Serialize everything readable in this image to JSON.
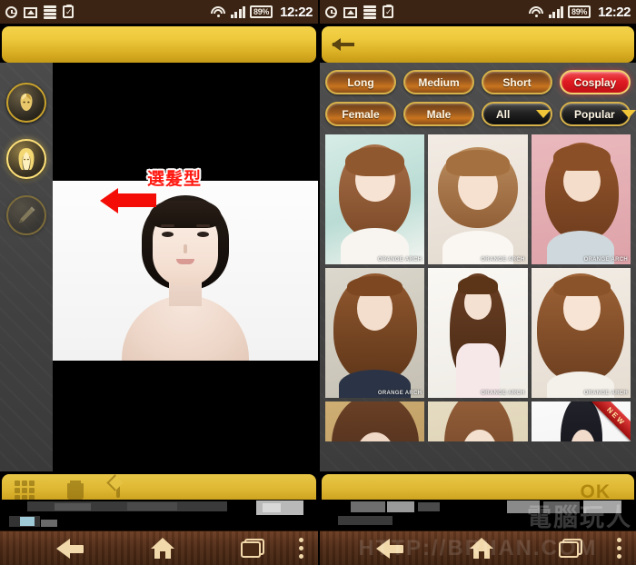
{
  "status_bar": {
    "icons": [
      "alarm-icon",
      "gallery-icon",
      "stack-icon",
      "clipboard-check-icon"
    ],
    "wifi_icon": "wifi-icon",
    "signal_icon": "signal-bars-icon",
    "battery_text": "89%",
    "clock": "12:22"
  },
  "left_panel": {
    "tools": [
      {
        "name": "face-shape-tool",
        "label": "Face",
        "state": "normal"
      },
      {
        "name": "hairstyle-tool",
        "label": "Hairstyle",
        "state": "active"
      },
      {
        "name": "edit-pen-tool",
        "label": "Edit",
        "state": "disabled"
      }
    ],
    "annotation_text": "選髮型",
    "bottom_toolbar": {
      "grid_label": "Gallery",
      "trash_label": "Delete",
      "share_label": "Save"
    }
  },
  "right_panel": {
    "back_label": "Back",
    "filters": [
      {
        "label": "Long",
        "selected": false,
        "dropdown": false
      },
      {
        "label": "Medium",
        "selected": false,
        "dropdown": false
      },
      {
        "label": "Short",
        "selected": false,
        "dropdown": false
      },
      {
        "label": "Cosplay",
        "selected": true,
        "dropdown": false
      },
      {
        "label": "Female",
        "selected": false,
        "dropdown": false
      },
      {
        "label": "Male",
        "selected": false,
        "dropdown": false
      },
      {
        "label": "All",
        "selected": false,
        "dropdown": true
      },
      {
        "label": "Popular",
        "selected": false,
        "dropdown": true
      }
    ],
    "ok_label": "OK",
    "thumbnails": [
      {
        "id": 1,
        "watermark": "ORANGE ARCH",
        "badge": null,
        "hair": "#8b5a33",
        "bg": "#cfe6e2"
      },
      {
        "id": 2,
        "watermark": "ORANGE ARCH",
        "badge": null,
        "hair": "#a87c4e",
        "bg": "#efe7de"
      },
      {
        "id": 3,
        "watermark": "ORANGE ARCH",
        "badge": null,
        "hair": "#7d4a28",
        "bg": "#e7b9bd"
      },
      {
        "id": 4,
        "watermark": "ORANGE ARCH",
        "badge": null,
        "hair": "#7b4a2c",
        "bg": "#d8d3c9"
      },
      {
        "id": 5,
        "watermark": "ORANGE ARCH",
        "badge": null,
        "hair": "#5d3620",
        "bg": "#f4f1ec"
      },
      {
        "id": 6,
        "watermark": "ORANGE ARCH",
        "badge": null,
        "hair": "#8c5730",
        "bg": "#efe9e2"
      },
      {
        "id": 7,
        "watermark": "",
        "badge": null,
        "hair": "#5d3a24",
        "bg": "#c9a870"
      },
      {
        "id": 8,
        "watermark": "",
        "badge": null,
        "hair": "#8a5a33",
        "bg": "#e0d3b8"
      },
      {
        "id": 9,
        "watermark": "",
        "badge": "NEW",
        "hair": "#1c1c22",
        "bg": "#f2f2f2"
      }
    ]
  },
  "nav_bar": {
    "back_label": "Back",
    "home_label": "Home",
    "recents_label": "Recents",
    "menu_label": "Menu"
  },
  "watermarks": {
    "url": "HTTP://BRIIAN.COM",
    "site_cn": "電腦玩人"
  },
  "colors": {
    "status_bar_bg": "#3b2414",
    "gold_bar": "#e8c647",
    "panel_bg": "#444444",
    "accent_red": "#e01b22",
    "nav_bar_bg": "#512c17",
    "annotation_red": "#ff1a12"
  }
}
